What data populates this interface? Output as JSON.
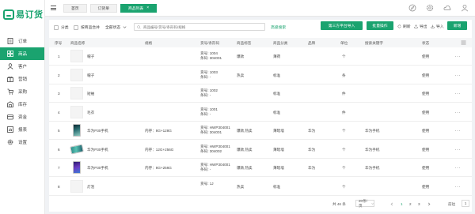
{
  "brand": {
    "name": "易订货"
  },
  "sidebar": {
    "items": [
      {
        "label": "订单",
        "icon": "order-icon"
      },
      {
        "label": "商品",
        "icon": "product-icon",
        "active": true
      },
      {
        "label": "客户",
        "icon": "customer-icon"
      },
      {
        "label": "营销",
        "icon": "marketing-icon"
      },
      {
        "label": "采购",
        "icon": "purchase-icon"
      },
      {
        "label": "库存",
        "icon": "inventory-icon"
      },
      {
        "label": "资金",
        "icon": "funds-icon"
      },
      {
        "label": "报表",
        "icon": "report-icon"
      },
      {
        "label": "设置",
        "icon": "settings-icon"
      }
    ]
  },
  "tabs": [
    {
      "label": "首页"
    },
    {
      "label": "订货单"
    },
    {
      "label": "商品列表",
      "active": true,
      "close": "×"
    }
  ],
  "filters": {
    "category": "分类",
    "merge": "按商品合并",
    "status": "全部状态",
    "search_placeholder": "商品编号/货号/条形码/规格",
    "advanced": "高级搜索"
  },
  "actions": {
    "third_party_import": "第三方平台导入",
    "batch": "批量操作",
    "refresh": "刷新",
    "export": "导出",
    "import": "导入",
    "add": "新增"
  },
  "columns": [
    "序号",
    "商品名称",
    "规格",
    "货号/条形码",
    "商品标签",
    "商品分类",
    "品牌",
    "单位",
    "搜索关键字",
    "状态"
  ],
  "rows": [
    {
      "index": "1",
      "name": "帽子",
      "spec": "",
      "code": "货号: 1004",
      "barcode": "条码: 304001",
      "tag": "爆款",
      "category": "薄荷",
      "brand": "",
      "unit": "个",
      "keyword": "",
      "status": "使用",
      "thumb": "blank"
    },
    {
      "index": "2",
      "name": "帽子",
      "spec": "",
      "code": "货号: 1003",
      "barcode": "条码: -",
      "tag": "热卖",
      "category": "标准",
      "brand": "",
      "unit": "条",
      "keyword": "",
      "status": "使用",
      "thumb": "blank"
    },
    {
      "index": "3",
      "name": "短袖",
      "spec": "",
      "code": "货号: 1002",
      "barcode": "条码: -",
      "tag": "",
      "category": "标准",
      "brand": "",
      "unit": "件",
      "keyword": "",
      "status": "使用",
      "thumb": "blank"
    },
    {
      "index": "4",
      "name": "毛衣",
      "spec": "",
      "code": "货号: 1001",
      "barcode": "条码: -",
      "tag": "",
      "category": "标准",
      "brand": "",
      "unit": "件",
      "keyword": "",
      "status": "使用",
      "thumb": "blank"
    },
    {
      "index": "5",
      "name": "华为P30手机",
      "spec": "内存：8G+128G",
      "code": "货号: HWP304001",
      "barcode": "条码: 304001",
      "tag": "爆款,热卖",
      "category": "薄暗墙",
      "brand": "华为",
      "unit": "个",
      "keyword": "华为手机",
      "status": "使用",
      "thumb": "phone1"
    },
    {
      "index": "6",
      "name": "华为P30手机",
      "spec": "内存：12G+256G",
      "code": "货号: HWP304001",
      "barcode": "条码: 304002",
      "tag": "爆款,热卖",
      "category": "薄暗墙",
      "brand": "华为",
      "unit": "个",
      "keyword": "华为手机",
      "status": "使用",
      "thumb": "phone2"
    },
    {
      "index": "7",
      "name": "华为P30手机",
      "spec": "内存：8G+256G",
      "code": "货号: HWP304001",
      "barcode": "条码: -",
      "tag": "爆款,热卖",
      "category": "薄暗墙",
      "brand": "华为",
      "unit": "个",
      "keyword": "华为手机",
      "status": "使用",
      "thumb": "phone3"
    },
    {
      "index": "8",
      "name": "灯泡",
      "spec": "",
      "code": "货号: 1J",
      "barcode": "",
      "tag": "热卖",
      "category": "标准",
      "brand": "",
      "unit": "个",
      "keyword": "",
      "status": "使用",
      "thumb": "blank"
    }
  ],
  "more_label": "···",
  "pagination": {
    "total": "共 46 条",
    "page_size": "20条/页",
    "pages": [
      "1",
      "2",
      "3"
    ],
    "current": "1",
    "goto_label": "前往",
    "goto_value": "1",
    "page_suffix": "页"
  },
  "colors": {
    "primary": "#1aa36f"
  }
}
